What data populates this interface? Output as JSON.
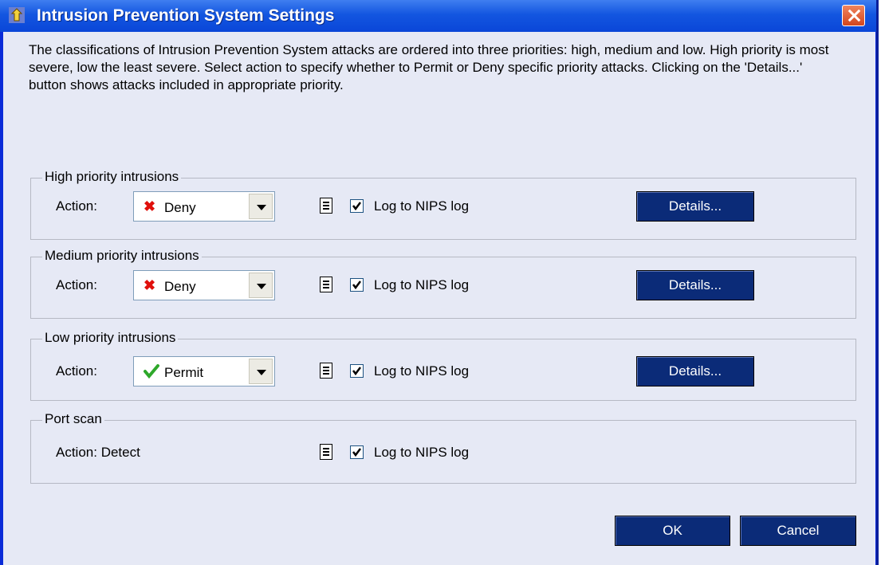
{
  "window": {
    "title": "Intrusion Prevention System Settings"
  },
  "description": "The classifications of Intrusion Prevention System attacks are ordered into three priorities: high, medium and low. High priority is most severe, low the least severe. Select action to specify whether to Permit or Deny specific priority attacks. Clicking on the 'Details...' button shows attacks included in appropriate priority.",
  "groups": [
    {
      "title": "High priority intrusions",
      "action_label": "Action:",
      "action_value": "Deny",
      "action_icon": "deny-x-icon",
      "log_label": "Log to NIPS log",
      "log_checked": true,
      "details_label": "Details..."
    },
    {
      "title": "Medium priority intrusions",
      "action_label": "Action:",
      "action_value": "Deny",
      "action_icon": "deny-x-icon",
      "log_label": "Log to NIPS log",
      "log_checked": true,
      "details_label": "Details..."
    },
    {
      "title": "Low priority intrusions",
      "action_label": "Action:",
      "action_value": "Permit",
      "action_icon": "permit-check-icon",
      "log_label": "Log to NIPS log",
      "log_checked": true,
      "details_label": "Details..."
    },
    {
      "title": "Port scan",
      "action_label": "Action: Detect",
      "log_label": "Log to NIPS log",
      "log_checked": true
    }
  ],
  "buttons": {
    "ok": "OK",
    "cancel": "Cancel"
  },
  "colors": {
    "deny": "#e0100c",
    "permit": "#2ea82a",
    "button_bg": "#0b2b78"
  }
}
